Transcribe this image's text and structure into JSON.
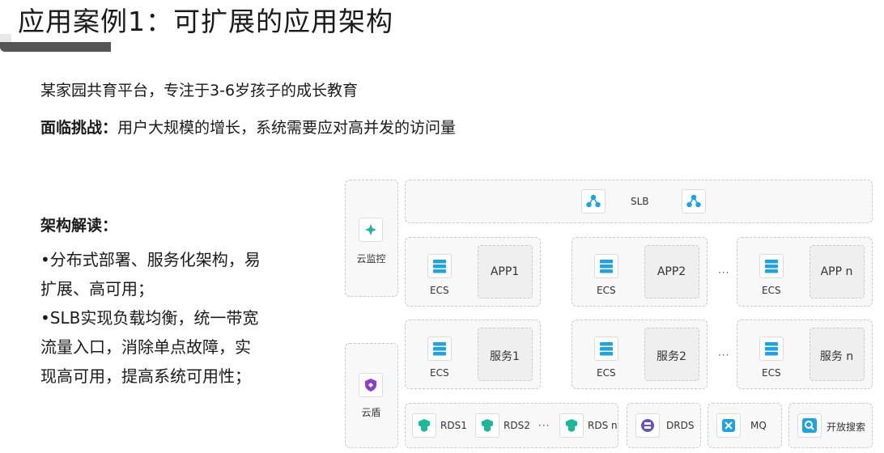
{
  "title": "应用案例1：可扩展的应用架构",
  "intro": {
    "line1": "某家园共育平台，专注于3-6岁孩子的成长教育",
    "challenge_label": "面临挑战：",
    "challenge_text": "用户大规模的增长，系统需要应对高并发的访问量"
  },
  "analysis": {
    "heading": "架构解读：",
    "lines": [
      "•分布式部署、服务化架构，易",
      "扩展、高可用；",
      "•SLB实现负载均衡，统一带宽",
      "流量入口，消除单点故障，实",
      "现高可用，提高系统可用性；"
    ]
  },
  "diagram": {
    "monitor_label": "云监控",
    "shield_label": "云盾",
    "slb_label": "SLB",
    "ecs_label": "ECS",
    "app_groups": [
      "APP1",
      "APP2",
      "APP n"
    ],
    "service_groups": [
      "服务1",
      "服务2",
      "服务 n"
    ],
    "ellipsis": "···",
    "rds": [
      "RDS1",
      "RDS2",
      "RDS n"
    ],
    "drds_label": "DRDS",
    "mq_label": "MQ",
    "search_label": "开放搜索",
    "colors": {
      "accent": "#1fa2e0",
      "green": "#1cb89a",
      "purple": "#6b4fc4"
    },
    "icons": [
      "monitor-icon",
      "shield-icon",
      "slb-icon",
      "ecs-icon",
      "rds-icon",
      "drds-icon",
      "mq-icon",
      "search-icon"
    ]
  }
}
